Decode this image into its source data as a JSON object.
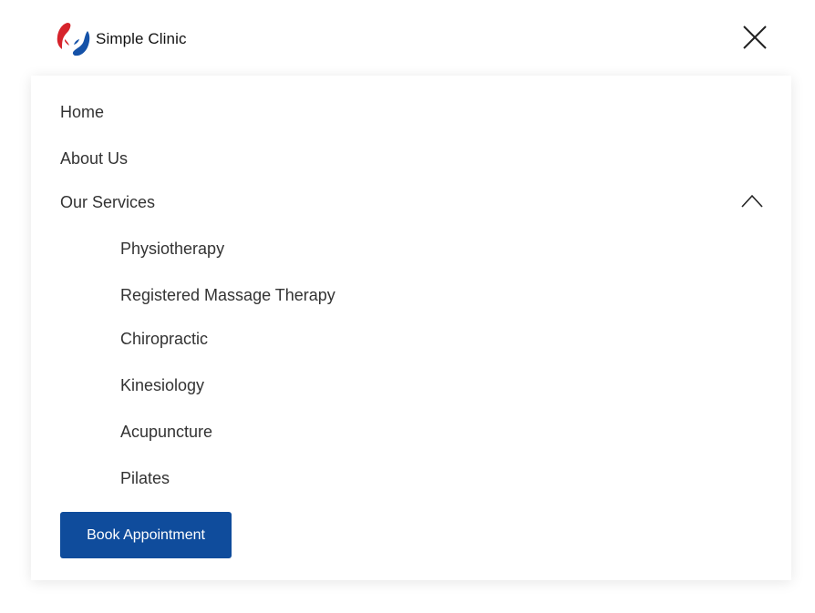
{
  "header": {
    "brand_name": "Simple Clinic",
    "logo_icon": "hands-logo-icon",
    "close_icon": "close-icon"
  },
  "nav": {
    "items": [
      {
        "label": "Home"
      },
      {
        "label": "About Us"
      },
      {
        "label": "Our Services",
        "expanded": true,
        "toggle_icon": "chevron-up-icon"
      }
    ],
    "services": [
      {
        "label": "Physiotherapy"
      },
      {
        "label": "Registered Massage Therapy"
      },
      {
        "label": "Chiropractic"
      },
      {
        "label": "Kinesiology"
      },
      {
        "label": "Acupuncture"
      },
      {
        "label": "Pilates"
      }
    ]
  },
  "cta": {
    "label": "Book Appointment"
  },
  "colors": {
    "brand_blue": "#0f4c9c",
    "brand_red": "#d6232b",
    "text": "#333333"
  }
}
